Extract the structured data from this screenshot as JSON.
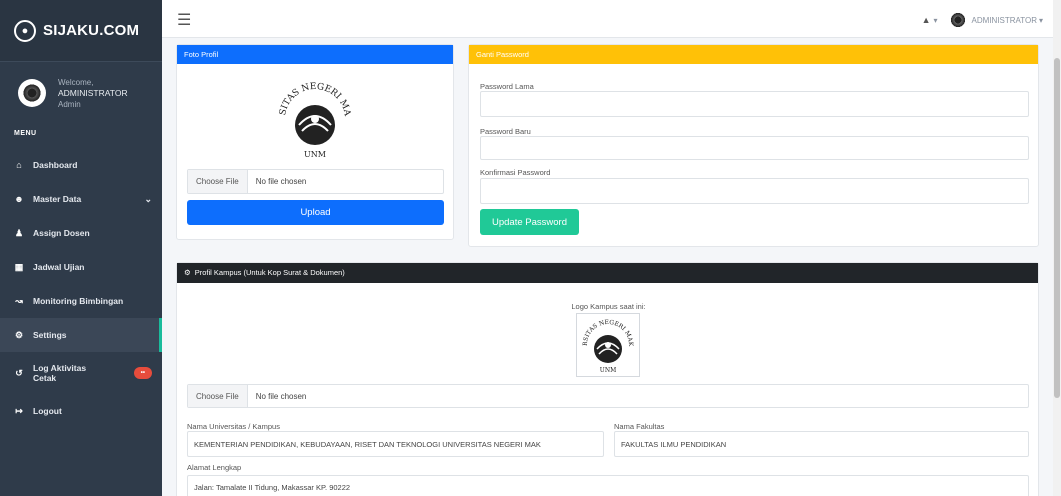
{
  "brand": {
    "name": "SIJAKU.COM"
  },
  "user": {
    "welcome": "Welcome,",
    "name": "ADMINISTRATOR",
    "role": "Admin"
  },
  "menu": {
    "label": "MENU",
    "items": [
      {
        "label": "Dashboard",
        "icon": "home-icon"
      },
      {
        "label": "Master Data",
        "icon": "users-icon"
      },
      {
        "label": "Assign Dosen",
        "icon": "user-plus-icon"
      },
      {
        "label": "Jadwal Ujian",
        "icon": "calendar-icon"
      },
      {
        "label": "Monitoring Bimbingan",
        "icon": "chart-line-icon"
      },
      {
        "label": "Settings",
        "icon": "gear-icon"
      },
      {
        "label": "Log Aktivitas Cetak",
        "icon": "history-icon",
        "badge": "••"
      },
      {
        "label": "Logout",
        "icon": "logout-icon"
      }
    ]
  },
  "topbar": {
    "user_label": "ADMINISTRATOR"
  },
  "foto_profil": {
    "title": "Foto Profil",
    "seal_text": "UNIVERSITAS NEGERI MAKASSAR",
    "seal_abbr": "UNM",
    "choose_label": "Choose File",
    "no_file": "No file chosen",
    "upload_label": "Upload"
  },
  "ganti_password": {
    "title": "Ganti Password",
    "old_label": "Password Lama",
    "new_label": "Password Baru",
    "confirm_label": "Konfirmasi Password",
    "button_label": "Update Password"
  },
  "profil_kampus": {
    "title": "Profil Kampus (Untuk Kop Surat & Dokumen)",
    "logo_label": "Logo Kampus saat ini:",
    "choose_label": "Choose File",
    "no_file": "No file chosen",
    "univ_label": "Nama Universitas / Kampus",
    "univ_value": "KEMENTERIAN PENDIDIKAN, KEBUDAYAAN, RISET DAN TEKNOLOGI UNIVERSITAS NEGERI MAK",
    "fakultas_label": "Nama Fakultas",
    "fakultas_value": "FAKULTAS ILMU PENDIDIKAN",
    "alamat_label": "Alamat Lengkap",
    "alamat_value": "Jalan: Tamalate II Tidung, Makassar KP. 90222"
  },
  "colors": {
    "sidebar": "#2f3b4a",
    "primary": "#0d6efd",
    "warning": "#ffc107",
    "success": "#20c997",
    "dark": "#212529"
  }
}
